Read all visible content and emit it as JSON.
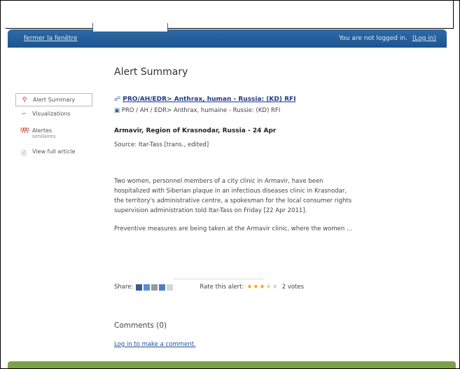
{
  "header": {
    "close_label": "fermer la fenêtre",
    "login_status": "You are not logged in.",
    "login_link": "(Log in)"
  },
  "page_title": "Alert Summary",
  "sidebar": {
    "items": [
      {
        "label": "Alert Summary",
        "icon": "pin-icon",
        "sub": ""
      },
      {
        "label": "Visualizations",
        "icon": "chart-icon",
        "sub": ""
      },
      {
        "label": "Alertes",
        "icon": "pins-icon",
        "sub": "similaires"
      },
      {
        "label": "View full article",
        "icon": "document-icon",
        "sub": ""
      }
    ]
  },
  "article": {
    "headline": "PRO/AH/EDR> Anthrax, human - Russia: (KD) RFI",
    "subline": "PRO / AH / EDR> Anthrax, humaine - Russie: (KD) RFI",
    "location": "Armavir, Region of Krasnodar, Russia - 24 Apr",
    "source": "Source: Itar-Tass [trans., edited]",
    "paragraph1": "Two women, personnel members of a city clinic in Armavir, have been hospitalized with Siberian plaque in an infectious diseases clinic in Krasnodar, the territory's administrative centre, a spokesman for the local consumer rights supervision administration told Itar-Tass on Friday [22 Apr 2011].",
    "paragraph2": "Preventive measures are being taken at the Armavir clinic, where the women ..."
  },
  "share": {
    "label": "Share:",
    "rate_label": "Rate this alert:",
    "rating": 3,
    "rating_max": 5,
    "votes": "2 votes"
  },
  "comments": {
    "title": "Comments (0)",
    "login_link": "Log in to make a comment."
  },
  "colors": {
    "header": "#2a65a0",
    "footer": "#7ba24a",
    "link": "#1e3a8a",
    "star": "#e8a317"
  }
}
